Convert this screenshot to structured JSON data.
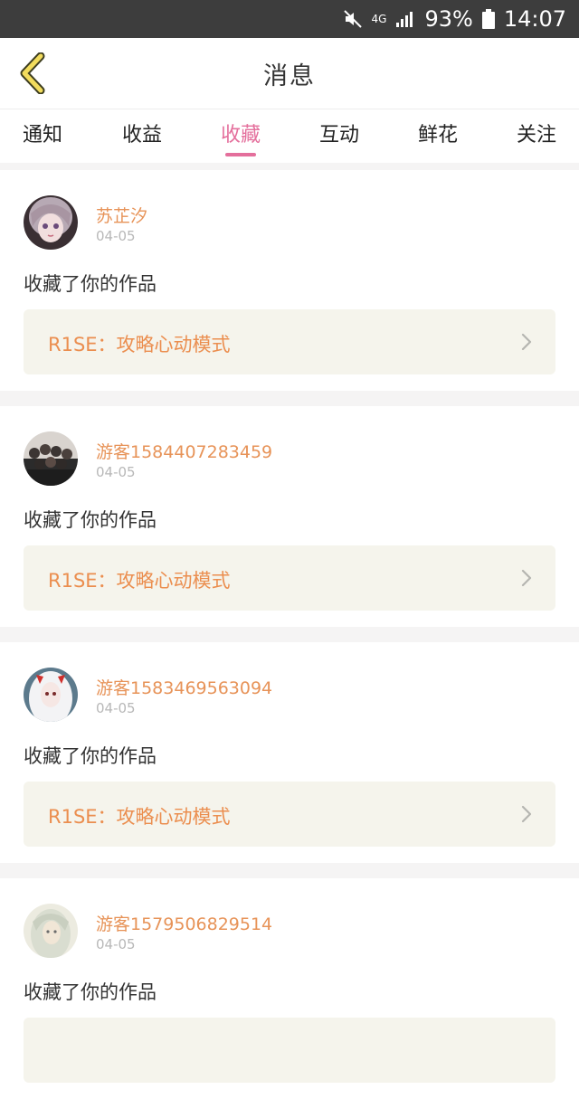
{
  "status_bar": {
    "network": "4G",
    "battery_percent": "93%",
    "time": "14:07",
    "icons": [
      "mute-icon",
      "network-4g-icon",
      "signal-icon",
      "battery-icon"
    ]
  },
  "header": {
    "title": "消息",
    "back_icon": "chevron-left-icon"
  },
  "tabs": [
    {
      "label": "通知",
      "active": false
    },
    {
      "label": "收益",
      "active": false
    },
    {
      "label": "收藏",
      "active": true
    },
    {
      "label": "互动",
      "active": false
    },
    {
      "label": "鲜花",
      "active": false
    },
    {
      "label": "关注",
      "active": false
    }
  ],
  "accent_color": "#e46f9c",
  "name_color": "#e79358",
  "messages": [
    {
      "user": "苏芷汐",
      "date": "04-05",
      "action": "收藏了你的作品",
      "work_title": "R1SE：攻略心动模式"
    },
    {
      "user": "游客1584407283459",
      "date": "04-05",
      "action": "收藏了你的作品",
      "work_title": "R1SE：攻略心动模式"
    },
    {
      "user": "游客1583469563094",
      "date": "04-05",
      "action": "收藏了你的作品",
      "work_title": "R1SE：攻略心动模式"
    },
    {
      "user": "游客1579506829514",
      "date": "04-05",
      "action": "收藏了你的作品",
      "work_title": ""
    }
  ]
}
